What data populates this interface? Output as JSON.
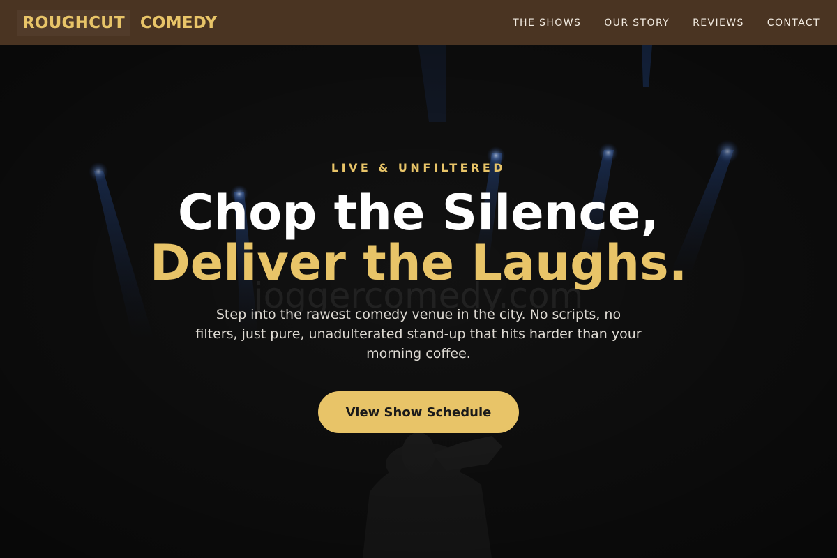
{
  "brand": {
    "word1": "ROUGHCUT",
    "word2": "COMEDY"
  },
  "nav": {
    "items": [
      {
        "label": "THE SHOWS"
      },
      {
        "label": "OUR STORY"
      },
      {
        "label": "REVIEWS"
      },
      {
        "label": "CONTACT"
      }
    ]
  },
  "hero": {
    "eyebrow": "LIVE & UNFILTERED",
    "headline_line1": "Chop the Silence,",
    "headline_line2": "Deliver the Laughs.",
    "subtext": "Step into the rawest comedy venue in the city. No scripts, no filters, just pure, unadulterated stand-up that hits harder than your morning coffee.",
    "cta_label": "View Show Schedule",
    "watermark": "joggercomedy.com"
  },
  "colors": {
    "header_bg": "#4a3422",
    "accent": "#e8c468",
    "hero_bg": "#121212",
    "spotlight": "#3a6cc8"
  },
  "icons": {
    "background_image": "stage-spotlights-performer-image"
  }
}
